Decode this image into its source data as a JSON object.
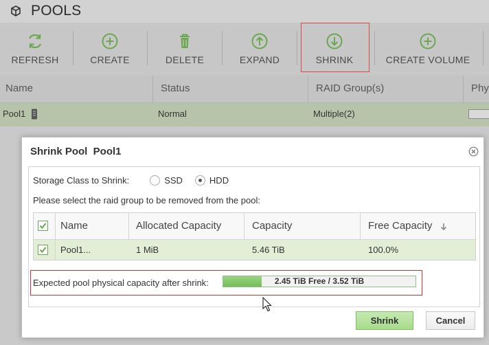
{
  "app": {
    "title": "POOLS",
    "icon": "cube-icon"
  },
  "toolbar": {
    "buttons": [
      {
        "label": "REFRESH",
        "icon": "refresh-icon"
      },
      {
        "label": "CREATE",
        "icon": "plus-circle-icon"
      },
      {
        "label": "DELETE",
        "icon": "trash-icon"
      },
      {
        "label": "EXPAND",
        "icon": "arrow-up-circle-icon"
      },
      {
        "label": "SHRINK",
        "icon": "arrow-down-circle-icon"
      },
      {
        "label": "CREATE VOLUME",
        "icon": "plus-circle-icon"
      }
    ]
  },
  "pools_grid": {
    "columns": [
      "Name",
      "Status",
      "RAID Group(s)",
      "Phy"
    ],
    "rows": [
      {
        "name": "Pool1",
        "status": "Normal",
        "raid_groups": "Multiple(2)"
      }
    ]
  },
  "dialog": {
    "title": "Shrink Pool  Pool1",
    "storage_class_label": "Storage Class to Shrink:",
    "options": [
      {
        "label": "SSD",
        "checked": false
      },
      {
        "label": "HDD",
        "checked": true
      }
    ],
    "instruction": "Please select the raid group to be removed from the pool:",
    "table": {
      "columns": [
        "Name",
        "Allocated Capacity",
        "Capacity",
        "Free Capacity"
      ],
      "rows": [
        {
          "checked": true,
          "name": "Pool1...",
          "allocated": "1 MiB",
          "capacity": "5.46 TiB",
          "free": "100.0%"
        }
      ]
    },
    "expected_label": "Expected pool physical capacity after shrink:",
    "capacity_bar": {
      "text": "2.45 TiB Free / 3.52 TiB",
      "fill_fraction": 0.2
    },
    "buttons": {
      "primary": "Shrink",
      "cancel": "Cancel"
    }
  },
  "colors": {
    "accent_green": "#6fbf55",
    "highlight_red": "#cc3333"
  }
}
